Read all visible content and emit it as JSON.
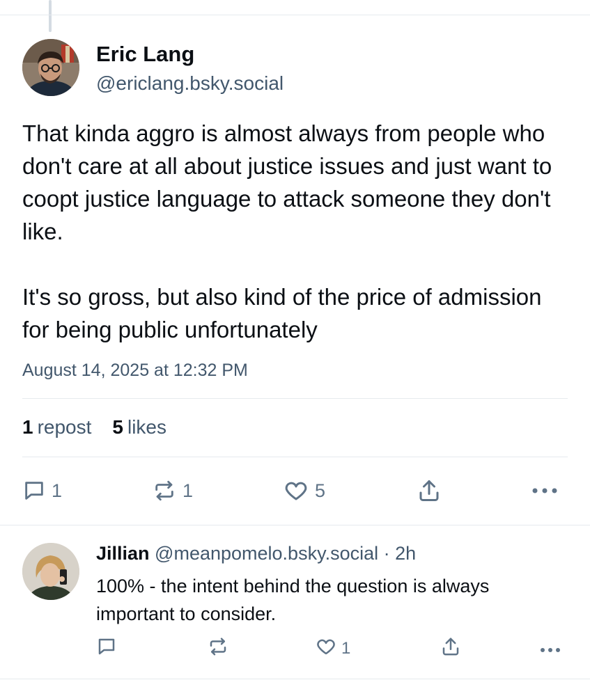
{
  "post": {
    "author_name": "Eric Lang",
    "author_handle": "@ericlang.bsky.social",
    "paragraphs": [
      "That kinda aggro is almost always from people who don't care at all about justice issues and just want to coopt justice language to attack someone they don't like.",
      "It's so gross, but also kind of the price of admission for being public unfortunately"
    ],
    "timestamp": "August 14, 2025 at 12:32 PM",
    "stats": {
      "reposts_count": "1",
      "reposts_label": "repost",
      "likes_count": "5",
      "likes_label": "likes"
    },
    "actions": {
      "reply_count": "1",
      "repost_count": "1",
      "like_count": "5",
      "share_icon": "share-icon",
      "more_icon": "more-icon"
    }
  },
  "reply": {
    "author_name": "Jillian",
    "author_handle": "@meanpomelo.bsky.social",
    "separator": "·",
    "age": "2h",
    "text": "100% - the intent behind the question is always important to consider.",
    "actions": {
      "reply_count": "",
      "repost_count": "",
      "like_count": "1"
    }
  },
  "colors": {
    "text_primary": "#0b0f14",
    "text_secondary": "#42576c",
    "icon": "#5f7387",
    "divider": "#e6eaee"
  }
}
